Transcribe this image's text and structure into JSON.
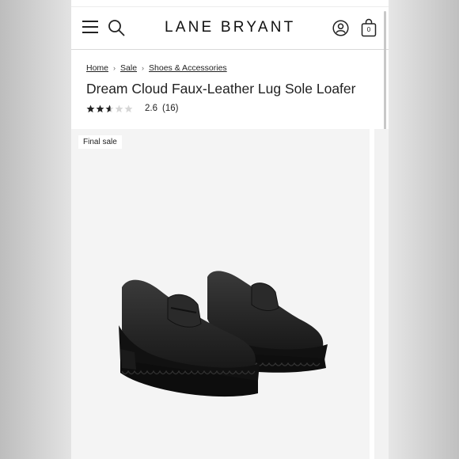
{
  "header": {
    "logo": "LANE BRYANT",
    "bag_count": "0",
    "icons": [
      "menu-icon",
      "search-icon",
      "account-icon",
      "shopping-bag-icon"
    ]
  },
  "breadcrumb": {
    "items": [
      "Home",
      "Sale",
      "Shoes & Accessories"
    ],
    "separator": "›"
  },
  "product": {
    "title": "Dream Cloud Faux-Leather Lug Sole Loafer",
    "rating_value": "2.6",
    "rating_count": "(16)",
    "rating_fraction": 0.52,
    "star_color": "#222222",
    "badge": "Final sale"
  },
  "colors": {
    "page_bg": "#ffffff",
    "image_bg": "#f4f4f4",
    "text": "#222222"
  }
}
